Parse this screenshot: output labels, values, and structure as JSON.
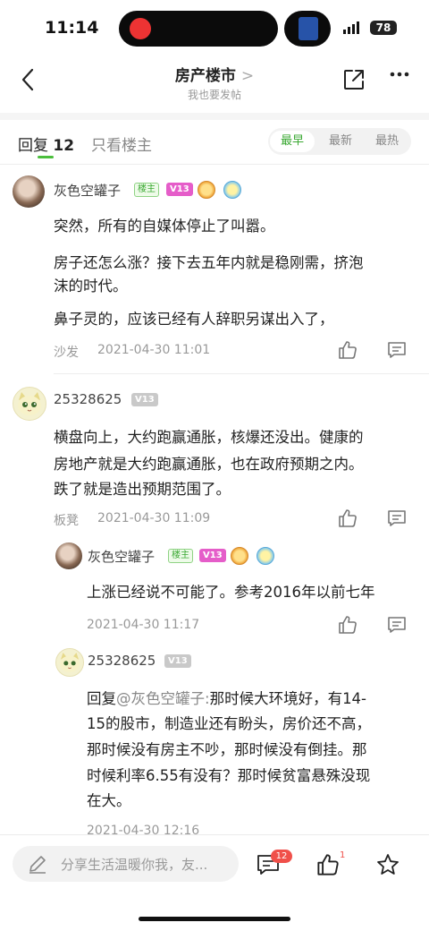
{
  "status": {
    "time": "11:14",
    "battery": "78"
  },
  "nav": {
    "title": "房产楼市",
    "title_chevron": ">",
    "subtitle": "我也要发帖"
  },
  "tabs": {
    "reply_label": "回复",
    "reply_count": "12",
    "op_only_label": "只看楼主"
  },
  "sort": {
    "earliest": "最早",
    "newest": "最新",
    "hottest": "最热",
    "selected": "最早"
  },
  "posts": [
    {
      "username": "灰色空罐子",
      "host_badge": "楼主",
      "level": "V13",
      "paragraphs": [
        "突然，所有的自媒体停止了叫嚣。",
        "房子还怎么涨？接下去五年内就是稳刚需，挤泡",
        "沫的时代。",
        "鼻子灵的，应该已经有人辞职另谋出入了，"
      ],
      "floor": "沙发",
      "date": "2021-04-30 11:01"
    },
    {
      "username": "25328625",
      "level": "V13",
      "lines": [
        "横盘向上，大约跑赢通胀，核爆还没出。健康的",
        "房地产就是大约跑赢通胀，也在政府预期之内。",
        "跌了就是造出预期范围了。"
      ],
      "floor": "板凳",
      "date": "2021-04-30 11:09",
      "replies": [
        {
          "username": "灰色空罐子",
          "host_badge": "楼主",
          "level": "V13",
          "text": "上涨已经说不可能了。参考2016年以前七年",
          "date": "2021-04-30 11:17"
        },
        {
          "username": "25328625",
          "level": "V13",
          "reply_prefix": "回复",
          "reply_to": "@灰色空罐子:",
          "lines_first": "那时候大环境好，有14-",
          "lines": [
            "15的股市，制造业还有盼头，房价还不高，",
            "那时候没有房主不吵，那时候没有倒挂。那",
            "时候利率6.55有没有？那时候贫富悬殊没现",
            "在大。"
          ],
          "date": "2021-04-30 12:16"
        }
      ]
    }
  ],
  "bottom": {
    "compose_placeholder": "分享生活温暖你我，友...",
    "comment_count": "12",
    "like_count": "1"
  },
  "icons": [
    "back-arrow-icon",
    "share-icon",
    "more-icon",
    "like-icon",
    "comment-icon",
    "pen-icon",
    "star-icon"
  ],
  "colors": {
    "accent": "#3aa832",
    "level_badge": "#e55dc9",
    "badge_red": "#f0504a"
  }
}
